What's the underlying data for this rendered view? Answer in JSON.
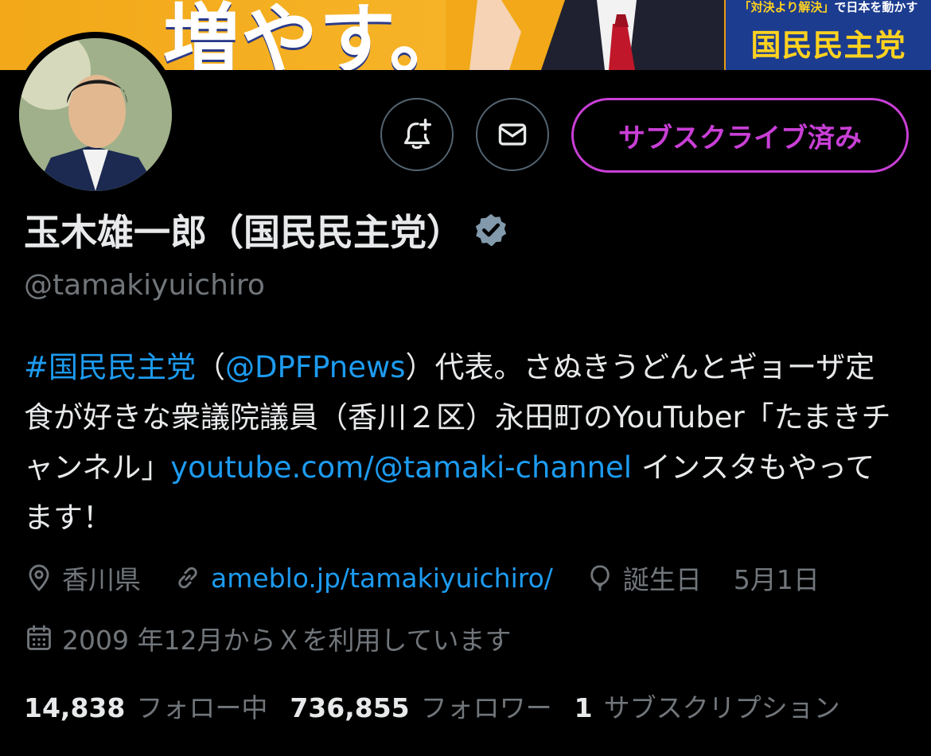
{
  "banner": {
    "headline": "増やす。",
    "slogan_prefix": "「対決より解決」",
    "slogan_suffix": "で日本を動かす",
    "party_name": "国民民主党"
  },
  "profile": {
    "display_name": "玉木雄一郎（国民民主党）",
    "handle": "@tamakiyuichiro",
    "verified_icon": "verified-badge-icon"
  },
  "actions": {
    "notify_icon": "bell-plus-icon",
    "dm_icon": "envelope-icon",
    "subscribed_label": "サブスクライブ済み"
  },
  "bio": {
    "hashtag": "#国民民主党",
    "open_paren": "（",
    "mention": "@DPFPnews",
    "text1": "）代表。さぬきうどんとギョーザ定食が好きな衆議院議員（香川２区）永田町のYouTuber「たまきチャンネル」",
    "url": "youtube.com/@tamaki-channel",
    "text2": " インスタもやってます！"
  },
  "meta": {
    "location": "香川県",
    "website": "ameblo.jp/tamakiyuichiro/",
    "birthday_label": "誕生日",
    "birthday_date": "5月1日",
    "joined": "2009 年12月からＸを利用しています"
  },
  "stats": {
    "following_count": "14,838",
    "following_label": "フォロー中",
    "followers_count": "736,855",
    "followers_label": "フォロワー",
    "subscriptions_count": "1",
    "subscriptions_label": "サブスクリプション"
  },
  "colors": {
    "accent_link": "#1d9bf0",
    "subscribe_purple": "#c93fd6",
    "muted": "#71767b",
    "banner_orange": "#f2a818",
    "banner_navy": "#1c3c8f",
    "banner_yellow": "#ffd21f"
  }
}
